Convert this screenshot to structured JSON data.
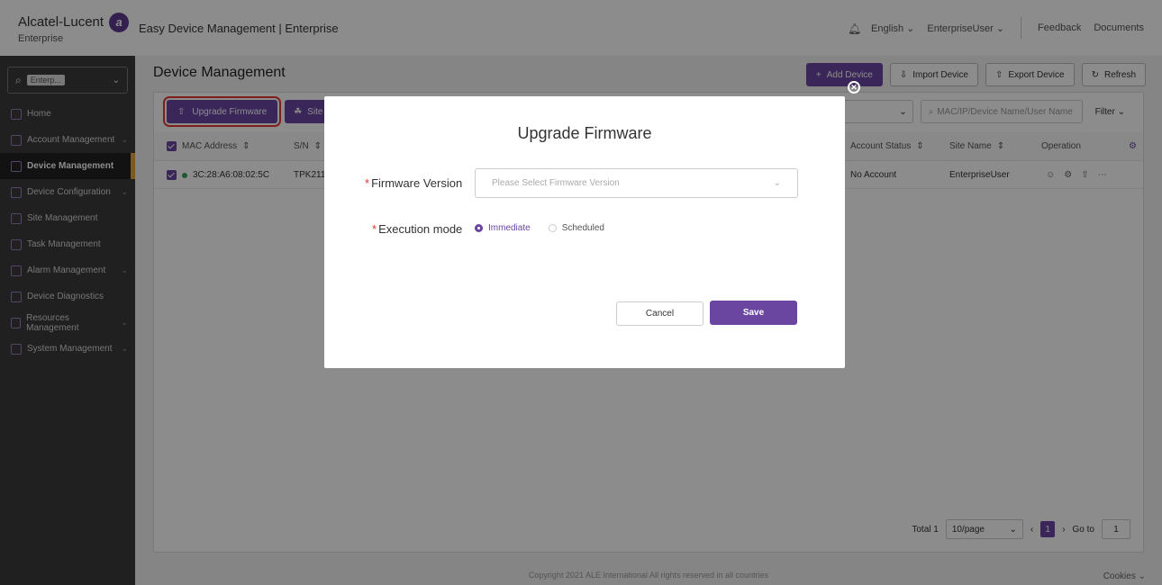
{
  "header": {
    "brand": "Alcatel-Lucent",
    "brand_sub": "Enterprise",
    "app_title": "Easy Device Management | Enterprise",
    "language": "English",
    "user": "EnterpriseUser",
    "feedback": "Feedback",
    "documents": "Documents"
  },
  "sidebar": {
    "search_tag": "Enterp...",
    "items": [
      {
        "label": "Home"
      },
      {
        "label": "Account Management"
      },
      {
        "label": "Device Management"
      },
      {
        "label": "Device Configuration"
      },
      {
        "label": "Site Management"
      },
      {
        "label": "Task Management"
      },
      {
        "label": "Alarm Management"
      },
      {
        "label": "Device Diagnostics"
      },
      {
        "label": "Resources Management"
      },
      {
        "label": "System Management"
      }
    ]
  },
  "main": {
    "title": "Device Management",
    "add_device": "Add Device",
    "import_device": "Import Device",
    "export_device": "Export Device",
    "refresh": "Refresh",
    "upgrade_firmware": "Upgrade Firmware",
    "site_btn": "Site",
    "search_placeholder": "MAC/IP/Device Name/User Name",
    "filter": "Filter",
    "columns": {
      "mac": "MAC Address",
      "sn": "S/N",
      "account_status": "Account Status",
      "site_name": "Site Name",
      "operation": "Operation"
    },
    "row": {
      "mac": "3C:28:A6:08:02:5C",
      "sn": "TPK211",
      "account_status": "No Account",
      "site_name": "EnterpriseUser"
    },
    "pager": {
      "total": "Total 1",
      "page_size": "10/page",
      "page": "1",
      "goto_label": "Go to",
      "goto_value": "1"
    },
    "copyright": "Copyright 2021 ALE International All rights reserved in all countries",
    "cookies": "Cookies"
  },
  "modal": {
    "title": "Upgrade Firmware",
    "firmware_label": "Firmware Version",
    "firmware_placeholder": "Please Select Firmware Version",
    "execution_label": "Execution mode",
    "immediate": "Immediate",
    "scheduled": "Scheduled",
    "cancel": "Cancel",
    "save": "Save"
  },
  "colors": {
    "accent": "#6a46a1",
    "highlight": "#e53935"
  }
}
